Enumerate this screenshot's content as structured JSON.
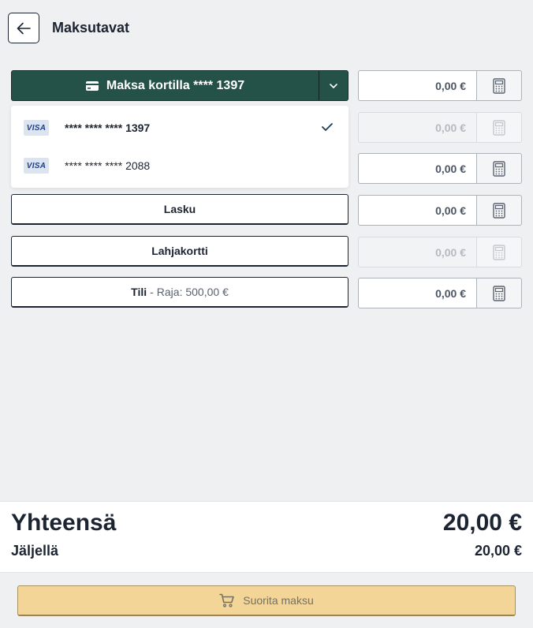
{
  "header": {
    "title": "Maksutavat",
    "back_icon": "arrow-left-icon"
  },
  "card_payment": {
    "label": "Maksa kortilla **** 1397",
    "card_icon": "credit-card-icon",
    "toggle_icon": "chevron-down-icon",
    "color": "#245148"
  },
  "card_dropdown": {
    "items": [
      {
        "brand": "VISA",
        "number": "**** **** ****",
        "last4": "1397",
        "selected": true
      },
      {
        "brand": "VISA",
        "number": "**** **** ****",
        "last4": "2088",
        "selected": false
      }
    ],
    "selected_icon": "checkmark-icon"
  },
  "methods": {
    "invoice": {
      "label": "Lasku"
    },
    "giftcard": {
      "label": "Lahjakortti"
    },
    "account": {
      "label": "Tili",
      "separator": "-",
      "limit": "Raja: 500,00 €"
    }
  },
  "amounts": [
    {
      "value": "0,00 €",
      "disabled": false
    },
    {
      "value": "0,00 €",
      "disabled": true
    },
    {
      "value": "0,00 €",
      "disabled": false
    },
    {
      "value": "0,00 €",
      "disabled": false
    },
    {
      "value": "0,00 €",
      "disabled": true
    },
    {
      "value": "0,00 €",
      "disabled": false
    }
  ],
  "calculator_icon": "calculator-icon",
  "summary": {
    "total_label": "Yhteensä",
    "total_value": "20,00 €",
    "remaining_label": "Jäljellä",
    "remaining_value": "20,00 €"
  },
  "footer": {
    "submit_label": "Suorita maksu",
    "submit_icon": "shopping-cart-icon",
    "submit_color": "#f3d597"
  }
}
